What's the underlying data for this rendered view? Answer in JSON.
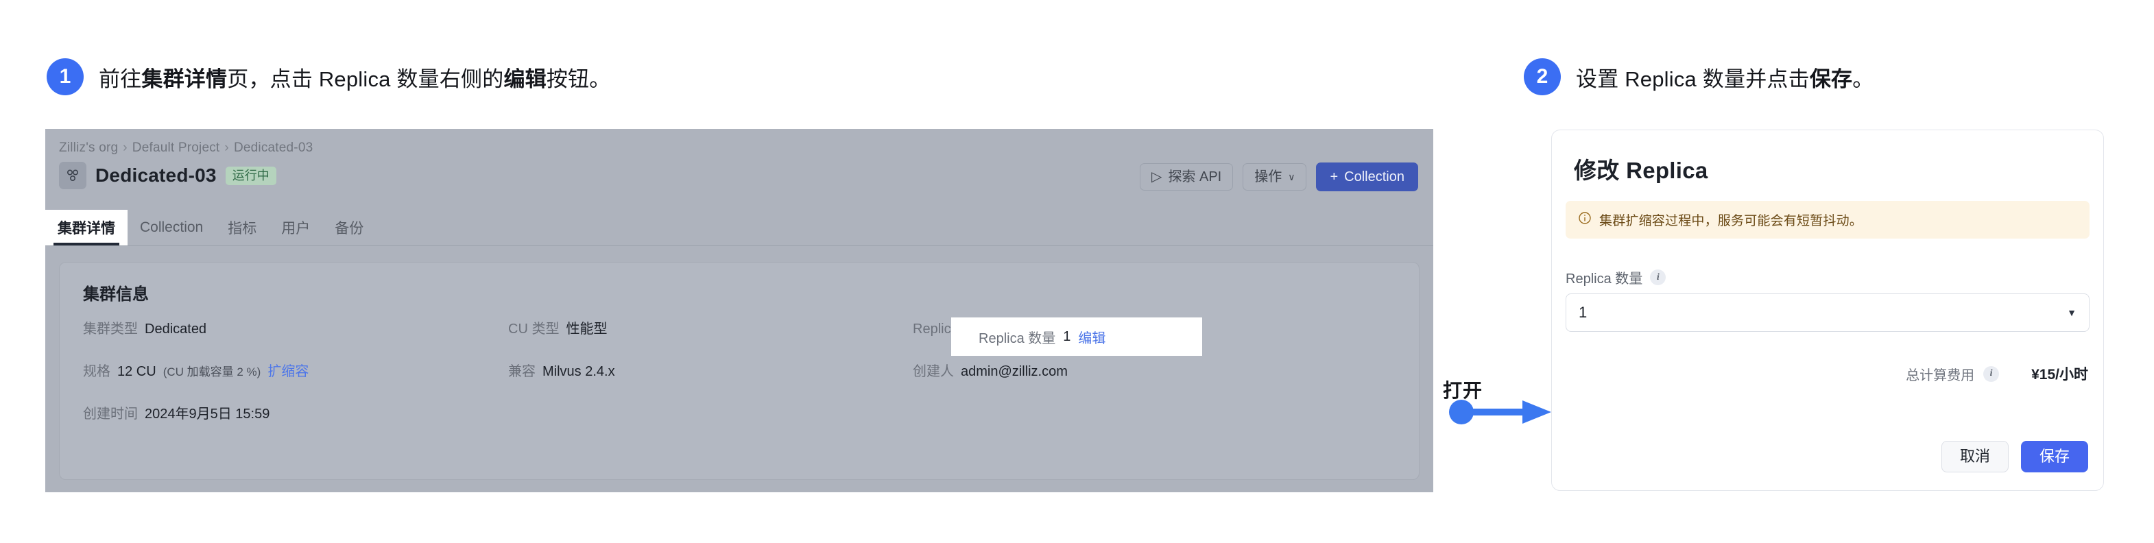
{
  "steps": [
    {
      "number": "1",
      "text_prefix": "前往",
      "text_bold1": "集群详情",
      "text_mid": "页，点击 Replica 数量右侧的",
      "text_bold2": "编辑",
      "text_suffix": "按钮。"
    },
    {
      "number": "2",
      "text_prefix": "设置 Replica 数量并点击",
      "text_bold1": "保存",
      "text_suffix": "。"
    }
  ],
  "connector": {
    "label": "打开",
    "color": "#3b78f0"
  },
  "console": {
    "breadcrumb": {
      "org": "Zilliz's org",
      "project": "Default Project",
      "cluster": "Dedicated-03",
      "separator": "›"
    },
    "title": "Dedicated-03",
    "status": "运行中",
    "icon": "cluster-nodes-icon",
    "actions": {
      "explore_api": "探索 API",
      "explore_api_icon": "play-triangle-icon",
      "operations": "操作",
      "operations_caret": "∨",
      "create_collection": "Collection",
      "create_collection_plus": "+"
    },
    "tabs": [
      {
        "label": "集群详情",
        "active": true
      },
      {
        "label": "Collection",
        "active": false
      },
      {
        "label": "指标",
        "active": false
      },
      {
        "label": "用户",
        "active": false
      },
      {
        "label": "备份",
        "active": false
      }
    ],
    "info_card": {
      "title": "集群信息",
      "rows": [
        {
          "col1": {
            "label": "集群类型",
            "value": "Dedicated"
          },
          "col2": {
            "label": "CU 类型",
            "value": "性能型"
          },
          "col3": {
            "label": "Replica 数量",
            "value": "1",
            "action": "编辑"
          }
        },
        {
          "col1": {
            "label": "规格",
            "value": "12 CU",
            "sub": "(CU 加载容量 2 %)",
            "action": "扩缩容"
          },
          "col2": {
            "label": "兼容",
            "value": "Milvus 2.4.x"
          },
          "col3": {
            "label": "创建人",
            "value": "admin@zilliz.com"
          }
        },
        {
          "col1": {
            "label": "创建时间",
            "value": "2024年9月5日 15:59"
          },
          "col2": {
            "label": "",
            "value": ""
          },
          "col3": {
            "label": "",
            "value": ""
          }
        }
      ]
    }
  },
  "dialog": {
    "title": "修改 Replica",
    "alert": {
      "icon": "info-circle-icon",
      "text": "集群扩缩容过程中，服务可能会有短暂抖动。"
    },
    "field": {
      "label": "Replica 数量",
      "info_icon": "i",
      "value": "1",
      "caret": "▼"
    },
    "cost": {
      "label": "总计算费用",
      "info_icon": "i",
      "value": "¥15/小时"
    },
    "buttons": {
      "cancel": "取消",
      "save": "保存"
    }
  }
}
